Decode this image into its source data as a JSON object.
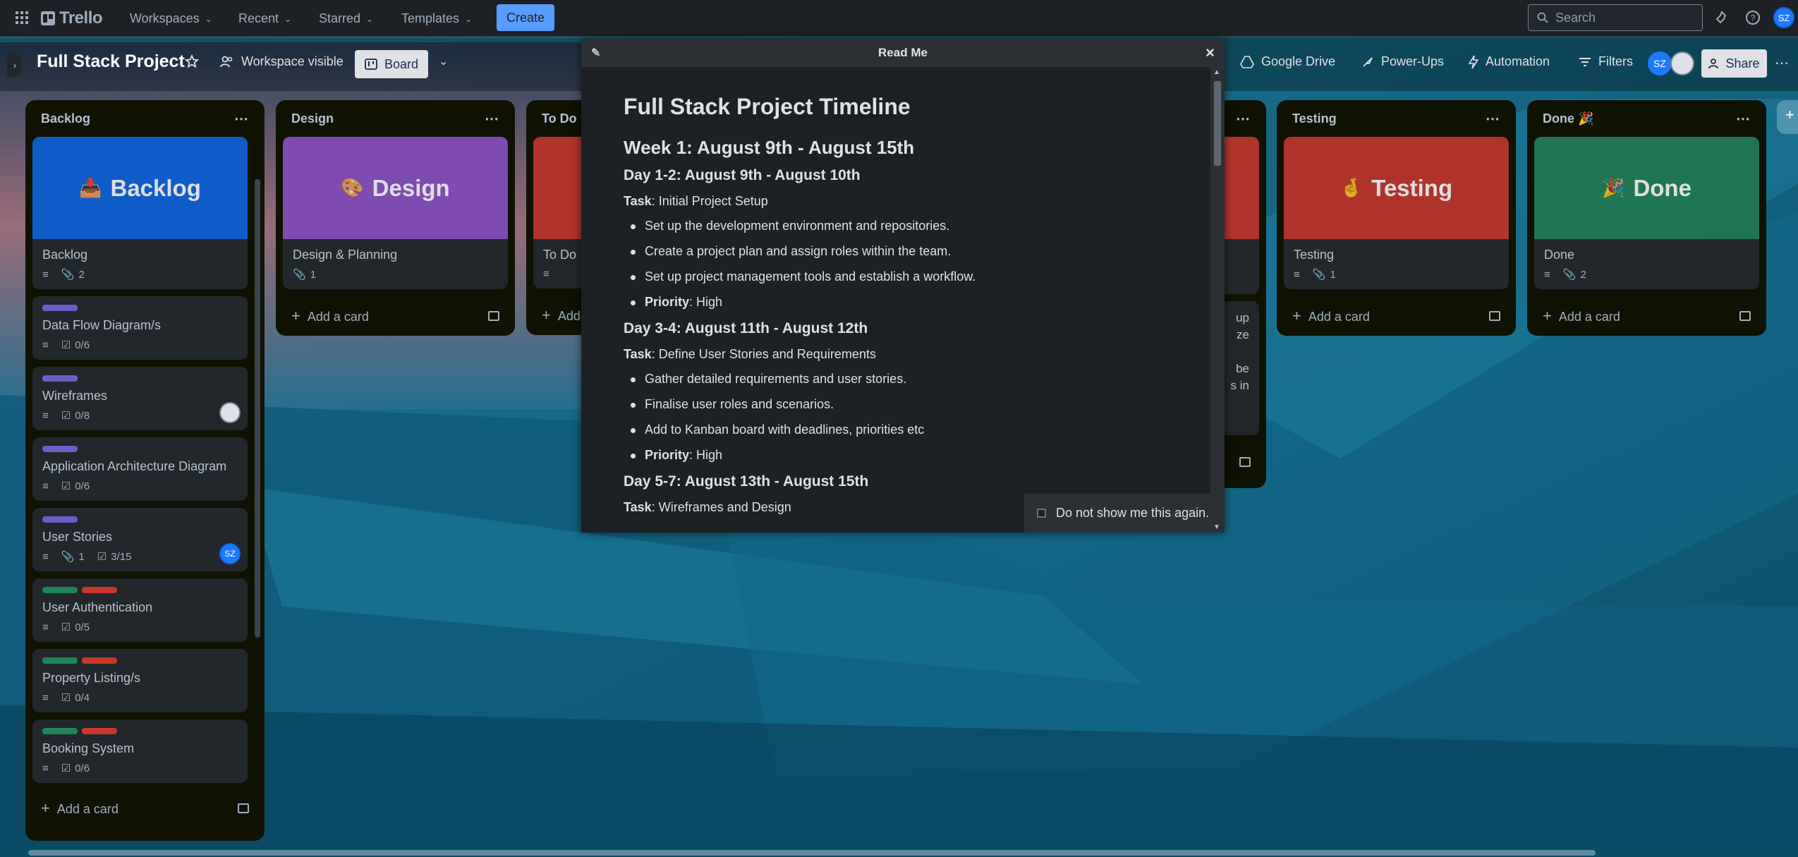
{
  "topnav": {
    "logo": "Trello",
    "menus": [
      "Workspaces",
      "Recent",
      "Starred",
      "Templates"
    ],
    "create_label": "Create",
    "search_placeholder": "Search",
    "avatar_initials": "SZ"
  },
  "board": {
    "title": "Full Stack Project",
    "visibility": "Workspace visible",
    "view_label": "Board",
    "google_drive": "Google Drive",
    "power_ups": "Power-Ups",
    "automation": "Automation",
    "filters": "Filters",
    "member_initials": "SZ",
    "share": "Share"
  },
  "lists": {
    "backlog": {
      "title": "Backlog",
      "cover_text": "Backlog",
      "cover_emoji": "📥",
      "cover_color": "#0c66e4",
      "cards": [
        {
          "title": "Backlog",
          "attachments": "2"
        },
        {
          "title": "Data Flow Diagram/s",
          "checklist": "0/6"
        },
        {
          "title": "Wireframes",
          "checklist": "0/8"
        },
        {
          "title": "Application Architecture Diagram",
          "checklist": "0/6"
        },
        {
          "title": "User Stories",
          "attachments": "1",
          "checklist": "3/15",
          "member": "SZ"
        },
        {
          "title": "User Authentication",
          "checklist": "0/5"
        },
        {
          "title": "Property Listing/s",
          "checklist": "0/4"
        },
        {
          "title": "Booking System",
          "checklist": "0/6"
        }
      ],
      "add_card": "Add a card"
    },
    "design": {
      "title": "Design",
      "cover_text": "Design",
      "cover_emoji": "🎨",
      "cover_color": "#8f53c8",
      "card_title": "Design & Planning",
      "attachments": "1",
      "add_card": "Add a card"
    },
    "todo": {
      "title": "To Do",
      "card_title": "To Do",
      "add_card": "Add a card",
      "cover_color": "#c9372c"
    },
    "hidden_fragment": {
      "lines": [
        "up",
        "ze",
        "be",
        "s in"
      ]
    },
    "testing": {
      "title": "Testing",
      "cover_text": "Testing",
      "cover_emoji": "🤞",
      "cover_color": "#c9372c",
      "card_title": "Testing",
      "attachments": "1",
      "add_card": "Add a card"
    },
    "done": {
      "title": "Done 🎉",
      "cover_text": "Done",
      "cover_emoji": "🎉",
      "cover_color": "#1f845a",
      "card_title": "Done",
      "attachments": "2",
      "add_card": "Add a card"
    }
  },
  "label_colors": {
    "purple": "#6e5dc6",
    "green": "#1f845a",
    "red": "#c9372c"
  },
  "modal": {
    "title": "Read Me",
    "doc_title": "Full Stack Project Timeline",
    "week1": "Week 1: August 9th - August 15th",
    "day12": {
      "heading": "Day 1-2: August 9th - August 10th",
      "task_label": "Task",
      "task": ": Initial Project Setup",
      "items": [
        "Set up the development environment and repositories.",
        "Create a project plan and assign roles within the team.",
        "Set up project management tools and establish a workflow."
      ],
      "priority_label": "Priority",
      "priority": ": High"
    },
    "day34": {
      "heading": "Day 3-4: August 11th - August 12th",
      "task_label": "Task",
      "task": ": Define User Stories and Requirements",
      "items": [
        "Gather detailed requirements and user stories.",
        "Finalise user roles and scenarios.",
        "Add to Kanban board with deadlines, priorities etc"
      ],
      "priority_label": "Priority",
      "priority": ": High"
    },
    "day57": {
      "heading": "Day 5-7: August 13th - August 15th",
      "task_label": "Task",
      "task": ": Wireframes and Design"
    },
    "dont_show": "Do not show me this again."
  }
}
